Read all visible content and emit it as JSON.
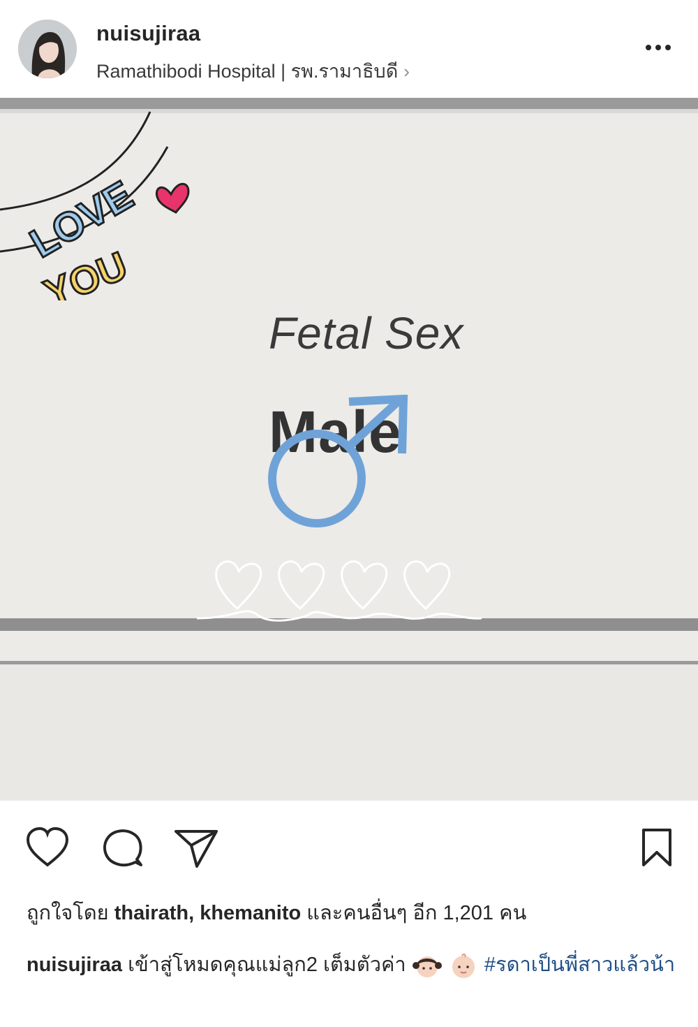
{
  "post": {
    "username": "nuisujiraa",
    "location": "Ramathibodi Hospital | รพ.รามาธิบดี",
    "location_chevron": "›"
  },
  "photo": {
    "sticker_text_top": "LOVE",
    "sticker_text_bottom": "YOU",
    "label": "Fetal Sex",
    "value": "Male"
  },
  "likes": {
    "prefix": "ถูกใจโดย",
    "names": "thairath, khemanito",
    "suffix": "และคนอื่นๆ อีก 1,201 คน"
  },
  "caption": {
    "username": "nuisujiraa",
    "text": "เข้าสู่โหมดคุณแม่ลูก2 เต็มตัวค่า",
    "hashtag": "#รดาเป็นพี่สาวแล้วน้า"
  },
  "icons": {
    "more": "more-options-icon",
    "like": "heart-icon",
    "comment": "comment-icon",
    "share": "paper-plane-icon",
    "save": "bookmark-icon"
  },
  "colors": {
    "text": "#262626",
    "hashtag": "#1f4f86",
    "male_symbol": "#6fa3d8",
    "sticker_blue": "#9ecbee",
    "sticker_yellow": "#f5d36b",
    "sticker_heart": "#e8346a"
  }
}
